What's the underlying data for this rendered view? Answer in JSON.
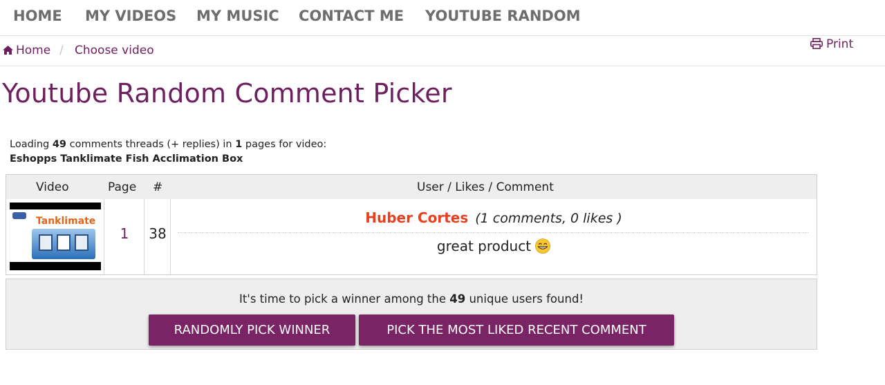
{
  "nav": {
    "items": [
      {
        "label": "HOME"
      },
      {
        "label": "MY VIDEOS"
      },
      {
        "label": "MY MUSIC"
      },
      {
        "label": "CONTACT ME"
      },
      {
        "label": "YOUTUBE RANDOM"
      }
    ]
  },
  "breadcrumb": {
    "home_label": "Home",
    "separator": "/",
    "current_label": "Choose video",
    "home_icon": "home-icon"
  },
  "print": {
    "label": "Print",
    "icon": "printer-icon"
  },
  "page": {
    "title": "Youtube Random Comment Picker"
  },
  "loading": {
    "prefix": "Loading",
    "thread_count": "49",
    "middle": "comments threads (+ replies) in",
    "page_count": "1",
    "suffix": "pages for video:",
    "video_title": "Eshopps Tanklimate Fish Acclimation Box"
  },
  "results": {
    "headers": {
      "video": "Video",
      "page": "Page",
      "number": "#",
      "user_comment": "User / Likes / Comment"
    },
    "row": {
      "thumbnail_text": "Tanklimate",
      "page": "1",
      "number": "38",
      "user": "Huber Cortes",
      "stats": "(1 comments, 0 likes )",
      "comment": "great product",
      "emoji": "grinning-face-emoji"
    }
  },
  "pick": {
    "prefix": "It's time to pick a winner among the",
    "user_count": "49",
    "suffix": "unique users found!",
    "random_button": "RANDOMLY PICK WINNER",
    "most_liked_button": "PICK THE MOST LIKED RECENT COMMENT"
  },
  "colors": {
    "brand": "#6e1f5f",
    "button": "#7a2466",
    "username": "#e8401f",
    "nav": "#6d6d6d"
  }
}
